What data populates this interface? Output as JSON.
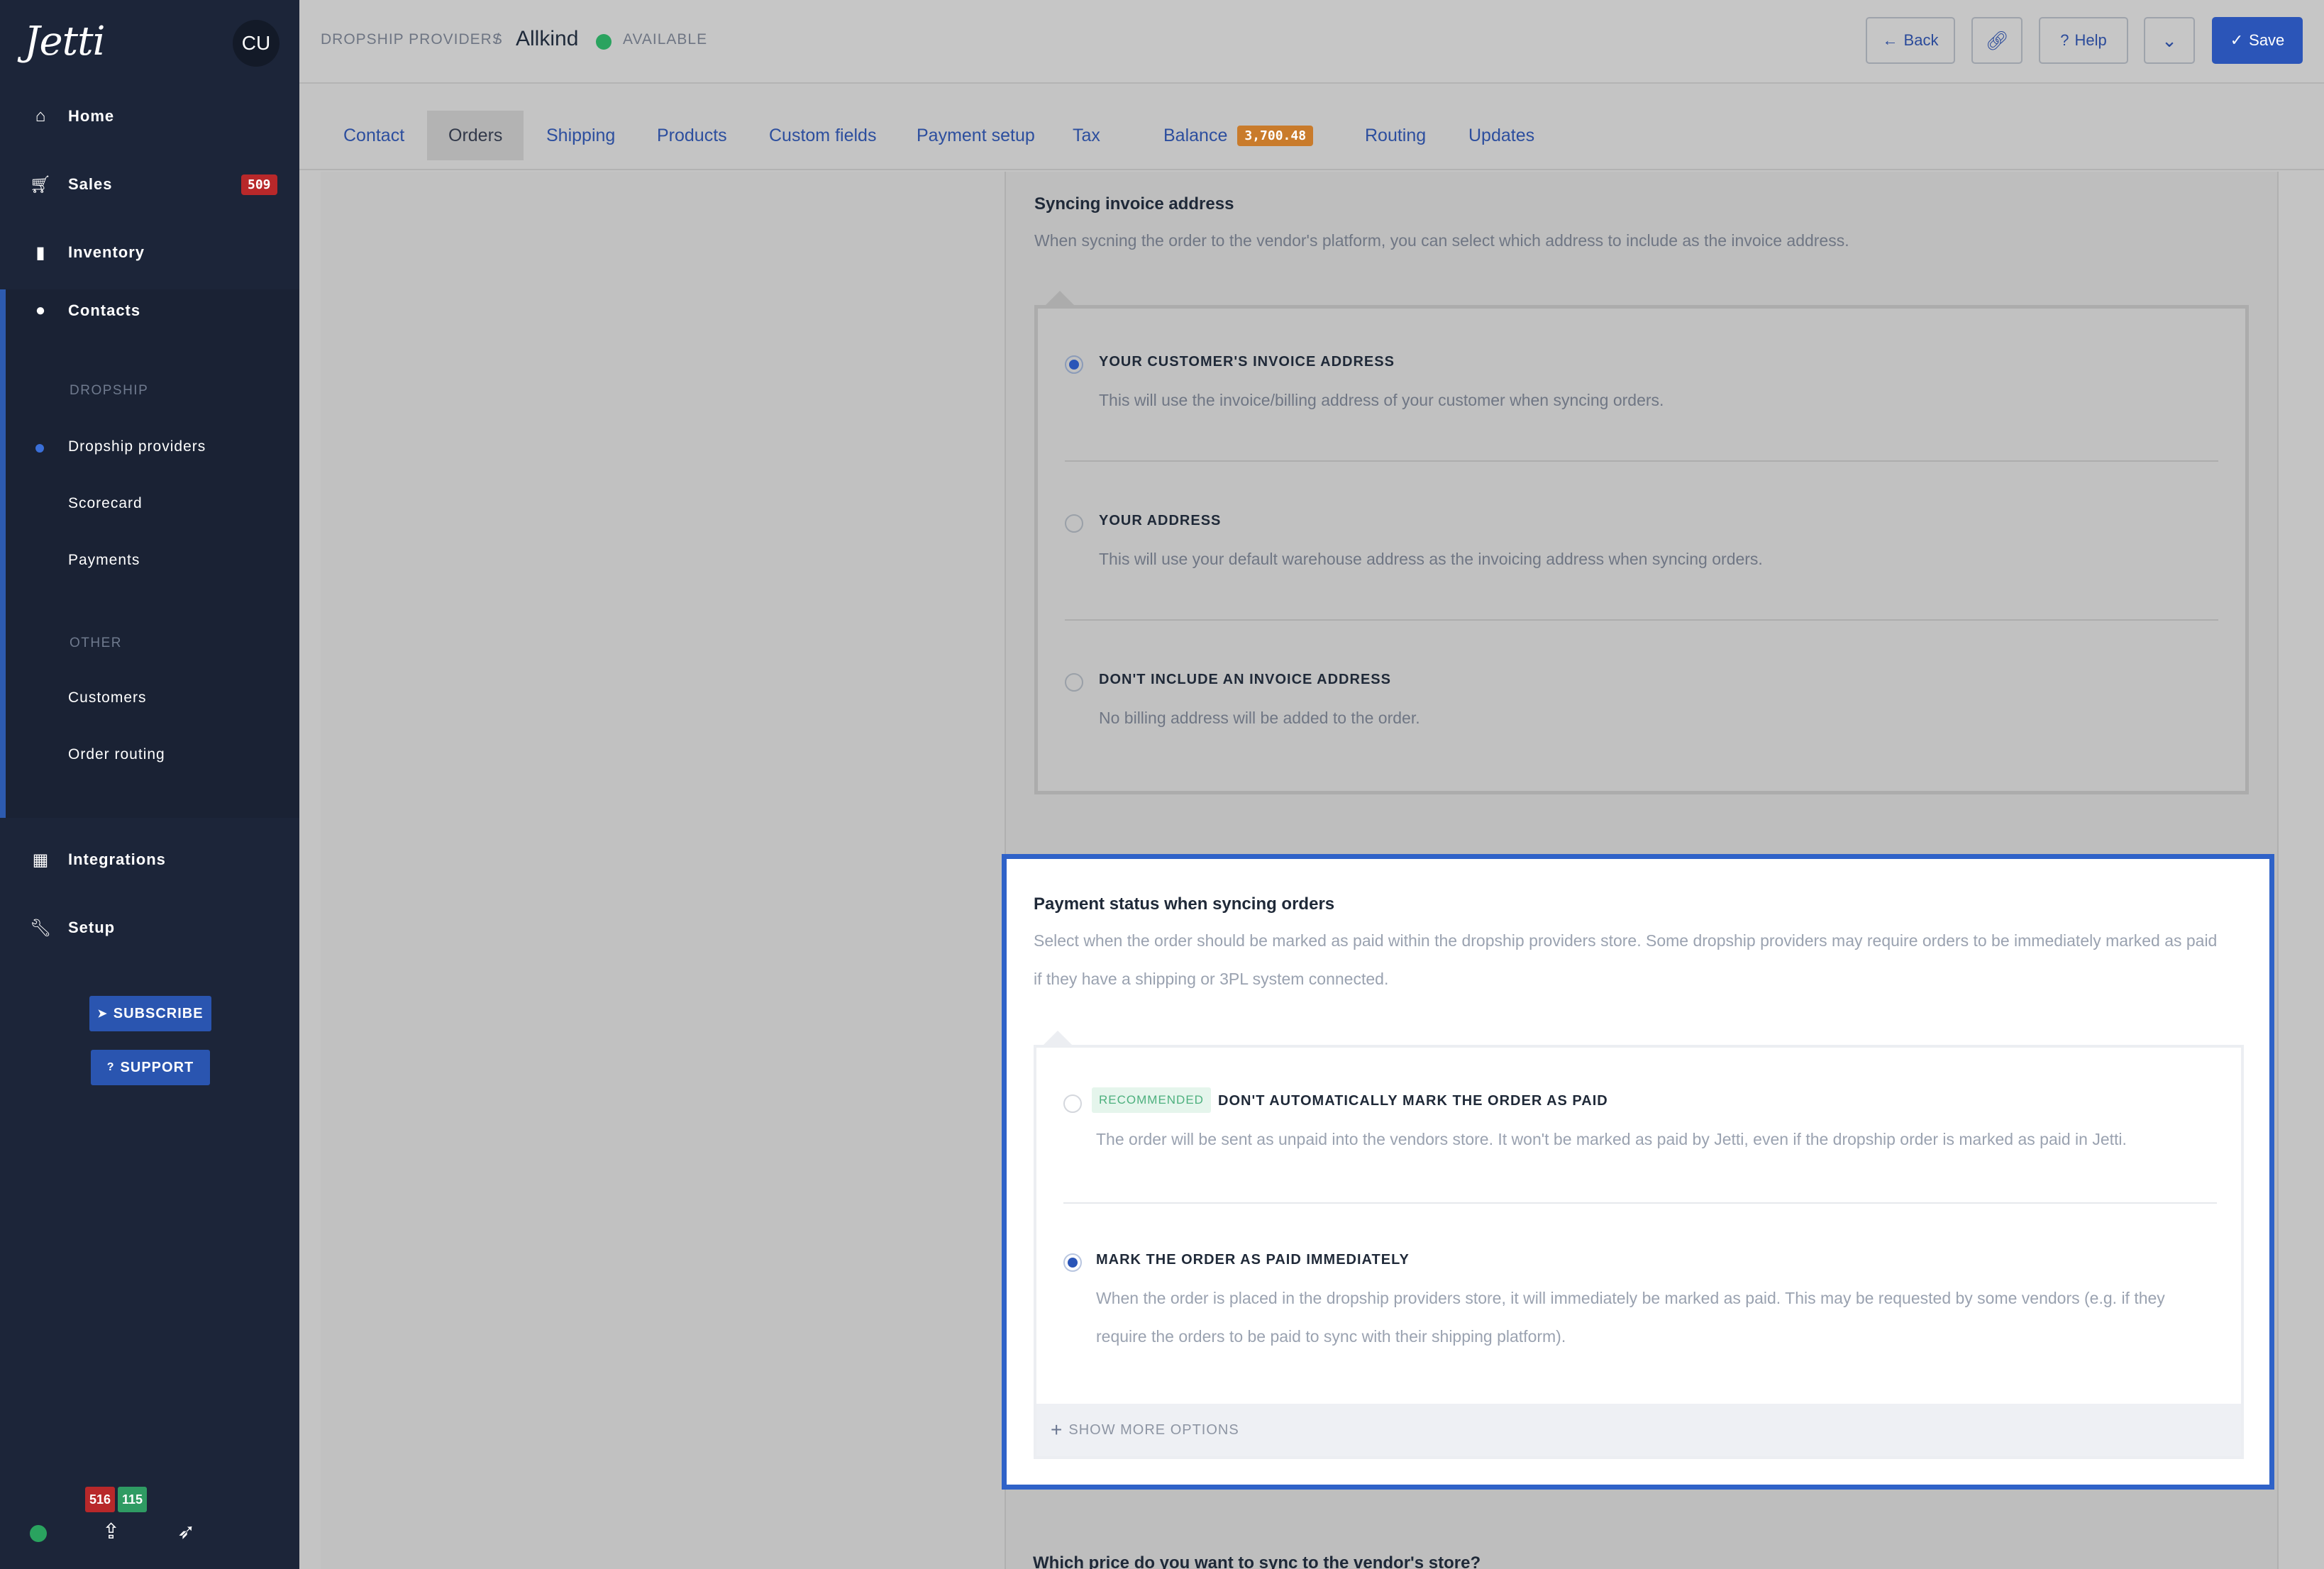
{
  "app": {
    "logo": "Jetti",
    "avatar": "CU"
  },
  "sidebar": {
    "items": [
      {
        "label": "Home",
        "icon": "home-icon"
      },
      {
        "label": "Sales",
        "icon": "cart-icon",
        "badge": "509"
      },
      {
        "label": "Inventory",
        "icon": "bookmark-icon"
      },
      {
        "label": "Contacts",
        "icon": "user-icon"
      }
    ],
    "dropship_section": "DROPSHIP",
    "dropship_items": [
      "Dropship providers",
      "Scorecard",
      "Payments"
    ],
    "other_section": "OTHER",
    "other_items": [
      "Customers",
      "Order routing"
    ],
    "bottom_items": [
      {
        "label": "Integrations",
        "icon": "grid-icon"
      },
      {
        "label": "Setup",
        "icon": "wrench-icon"
      }
    ],
    "subscribe_label": "SUBSCRIBE",
    "support_label": "SUPPORT",
    "counts": {
      "red": "516",
      "green": "115"
    },
    "colors": {
      "bg": "#1c2539",
      "accent": "#2d5bb0",
      "online": "#2aa35f"
    }
  },
  "header": {
    "breadcrumb": "DROPSHIP PROVIDERS",
    "separator": "/",
    "title": "Allkind",
    "status": "AVAILABLE",
    "back_label": "Back",
    "help_label": "Help",
    "save_label": "Save"
  },
  "tabs": [
    {
      "label": "Contact"
    },
    {
      "label": "Orders",
      "active": true
    },
    {
      "label": "Shipping"
    },
    {
      "label": "Products"
    },
    {
      "label": "Custom fields"
    },
    {
      "label": "Payment setup"
    },
    {
      "label": "Tax"
    },
    {
      "label": "Balance",
      "badge": "3,700.48"
    },
    {
      "label": "Routing"
    },
    {
      "label": "Updates"
    }
  ],
  "invoice": {
    "title": "Syncing invoice address",
    "desc": "When sycning the order to the vendor's platform, you can select which address to include as the invoice address.",
    "options": [
      {
        "title": "YOUR CUSTOMER'S INVOICE ADDRESS",
        "desc": "This will use the invoice/billing address of your customer when syncing orders.",
        "selected": true
      },
      {
        "title": "YOUR ADDRESS",
        "desc": "This will use your default warehouse address as the invoicing address when syncing orders.",
        "selected": false
      },
      {
        "title": "DON'T INCLUDE AN INVOICE ADDRESS",
        "desc": "No billing address will be added to the order.",
        "selected": false
      }
    ]
  },
  "payment": {
    "title": "Payment status when syncing orders",
    "desc_line1": "Select when the order should be marked as paid within the dropship providers store. Some dropship providers may require orders to be immediately marked as paid",
    "desc_line2": "if they have a shipping or 3PL system connected.",
    "options": [
      {
        "tag": "RECOMMENDED",
        "title": "DON'T AUTOMATICALLY MARK THE ORDER AS PAID",
        "desc": "The order will be sent as unpaid into the vendors store. It won't be marked as paid by Jetti, even if the dropship order is marked as paid in Jetti.",
        "selected": false
      },
      {
        "title": "MARK THE ORDER AS PAID IMMEDIATELY",
        "desc_line1": "When the order is placed in the dropship providers store, it will immediately be marked as paid. This may be requested by some vendors (e.g. if they",
        "desc_line2": "require the orders to be paid to sync with their shipping platform).",
        "selected": true
      }
    ],
    "show_more": "SHOW MORE OPTIONS"
  },
  "next_question": "Which price do you want to sync to the vendor's store?"
}
